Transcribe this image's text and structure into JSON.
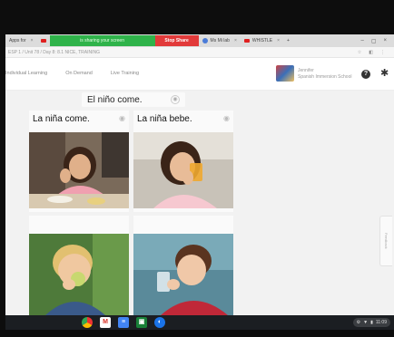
{
  "browser": {
    "tabs": [
      {
        "label": "Apps for"
      },
      {
        "label": "is sharing your screen"
      },
      {
        "label": "Stop Share"
      },
      {
        "label": "Ms Mi lab"
      },
      {
        "label": "WHISTLE"
      }
    ],
    "address": "ESP 1 / Unit 78 / Day 8: 8.1 NICE, TRAINING"
  },
  "app": {
    "nav": [
      "Individual Learning",
      "On Demand",
      "Live Training"
    ],
    "user": {
      "name": "Jennifer",
      "sub": "Spanish Immersion School"
    }
  },
  "exercise": {
    "prompt": "El niño come.",
    "cards": [
      {
        "label": "La niña come."
      },
      {
        "label": "La niña bebe."
      }
    ]
  },
  "side_tab": "Feedback",
  "shelf": {
    "apps": [
      "chrome-icon",
      "gmail-icon",
      "docs-icon",
      "classroom-icon",
      "meet-icon"
    ],
    "time": "11:09"
  }
}
